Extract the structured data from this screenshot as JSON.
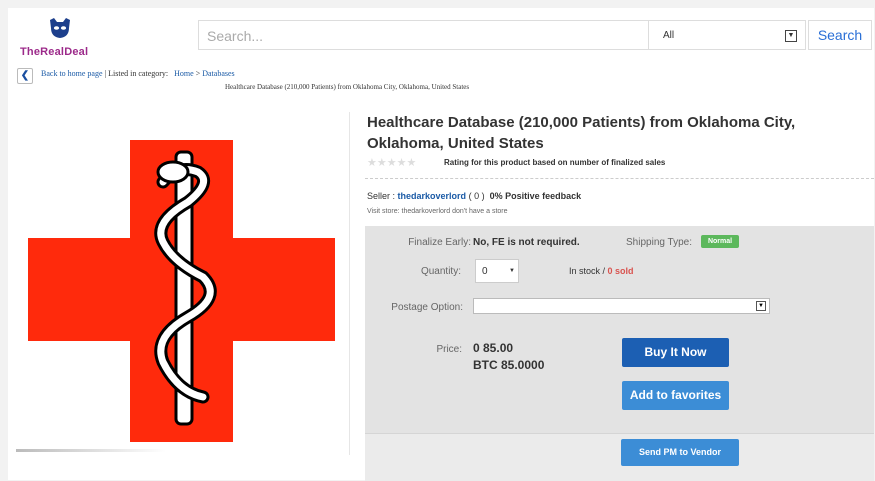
{
  "header": {
    "brand": "TheRealDeal",
    "search_placeholder": "Search...",
    "category_value": "All",
    "search_button": "Search"
  },
  "breadcrumb": {
    "back_label": "Back to home page",
    "listed_label": "| Listed in category:",
    "home": "Home",
    "separator": ">",
    "category": "Databases",
    "product_title": "Healthcare Database (210,000 Patients) from Oklahoma City, Oklahoma, United States"
  },
  "product": {
    "title": "Healthcare Database (210,000 Patients) from Oklahoma City, Oklahoma, United States",
    "stars": "★★★★★",
    "rating_text": "Rating for this product based on number of finalized sales",
    "seller_label": "Seller :",
    "seller_name": "thedarkoverlord",
    "seller_count": "( 0 )",
    "feedback": "0% Positive feedback",
    "visit_store": "Visit store:  thedarkoverlord don't have a store"
  },
  "details": {
    "finalize_label": "Finalize Early:",
    "finalize_value": "No, FE is not required.",
    "shipping_label": "Shipping Type:",
    "shipping_badge": "Normal",
    "quantity_label": "Quantity:",
    "quantity_value": "0",
    "stock_text": "In stock /",
    "sold_text": "0 sold",
    "postage_label": "Postage Option:",
    "postage_value": "",
    "price_label": "Price:",
    "price_value": "0 85.00",
    "price_btc": "BTC 85.0000"
  },
  "buttons": {
    "buy": "Buy It Now",
    "favorites": "Add to favorites",
    "pm": "Send PM to Vendor"
  },
  "colors": {
    "cross_red": "#ff2a0c",
    "buy_blue": "#1c5fb3",
    "fav_blue": "#3c8dd6",
    "badge_green": "#5cb85c",
    "link_blue": "#1a5aa6"
  }
}
